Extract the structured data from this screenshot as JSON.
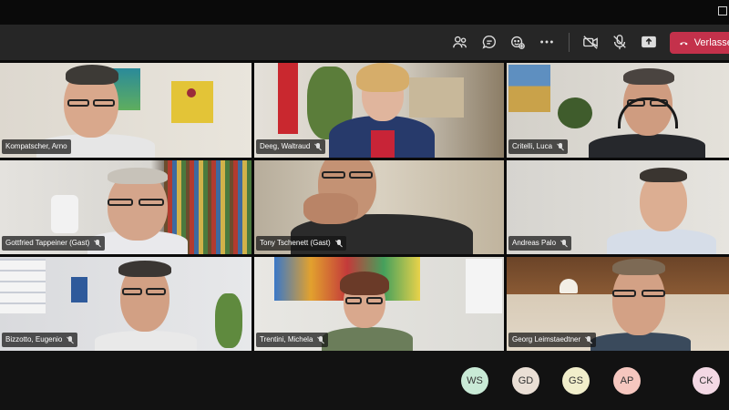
{
  "toolbar": {
    "leave_label": "Verlassen",
    "colors": {
      "leave": "#c4314b",
      "bar": "#262626"
    },
    "icons": [
      "people-icon",
      "chat-icon",
      "reactions-icon",
      "more-icon",
      "camera-off-icon",
      "mic-off-icon",
      "share-icon",
      "phone-hangup-icon"
    ]
  },
  "participants": [
    {
      "name": "Kompatscher, Arno"
    },
    {
      "name": "Deeg, Waltraud"
    },
    {
      "name": "Critelli, Luca"
    },
    {
      "name": "Gottfried Tappeiner (Gast)"
    },
    {
      "name": "Tony Tschenett (Gast)"
    },
    {
      "name": "Andreas Palo"
    },
    {
      "name": "Bizzotto, Eugenio"
    },
    {
      "name": "Trentini, Michela"
    },
    {
      "name": "Georg Leimstaedtner"
    }
  ],
  "overflow": [
    {
      "initials": "WS",
      "color": "#c9ead6"
    },
    {
      "initials": "GD",
      "color": "#eadfd5"
    },
    {
      "initials": "GS",
      "color": "#f1eecb"
    },
    {
      "initials": "AP",
      "color": "#f6c7bf"
    },
    {
      "initials": "CK",
      "color": "#f3d8e4"
    }
  ]
}
